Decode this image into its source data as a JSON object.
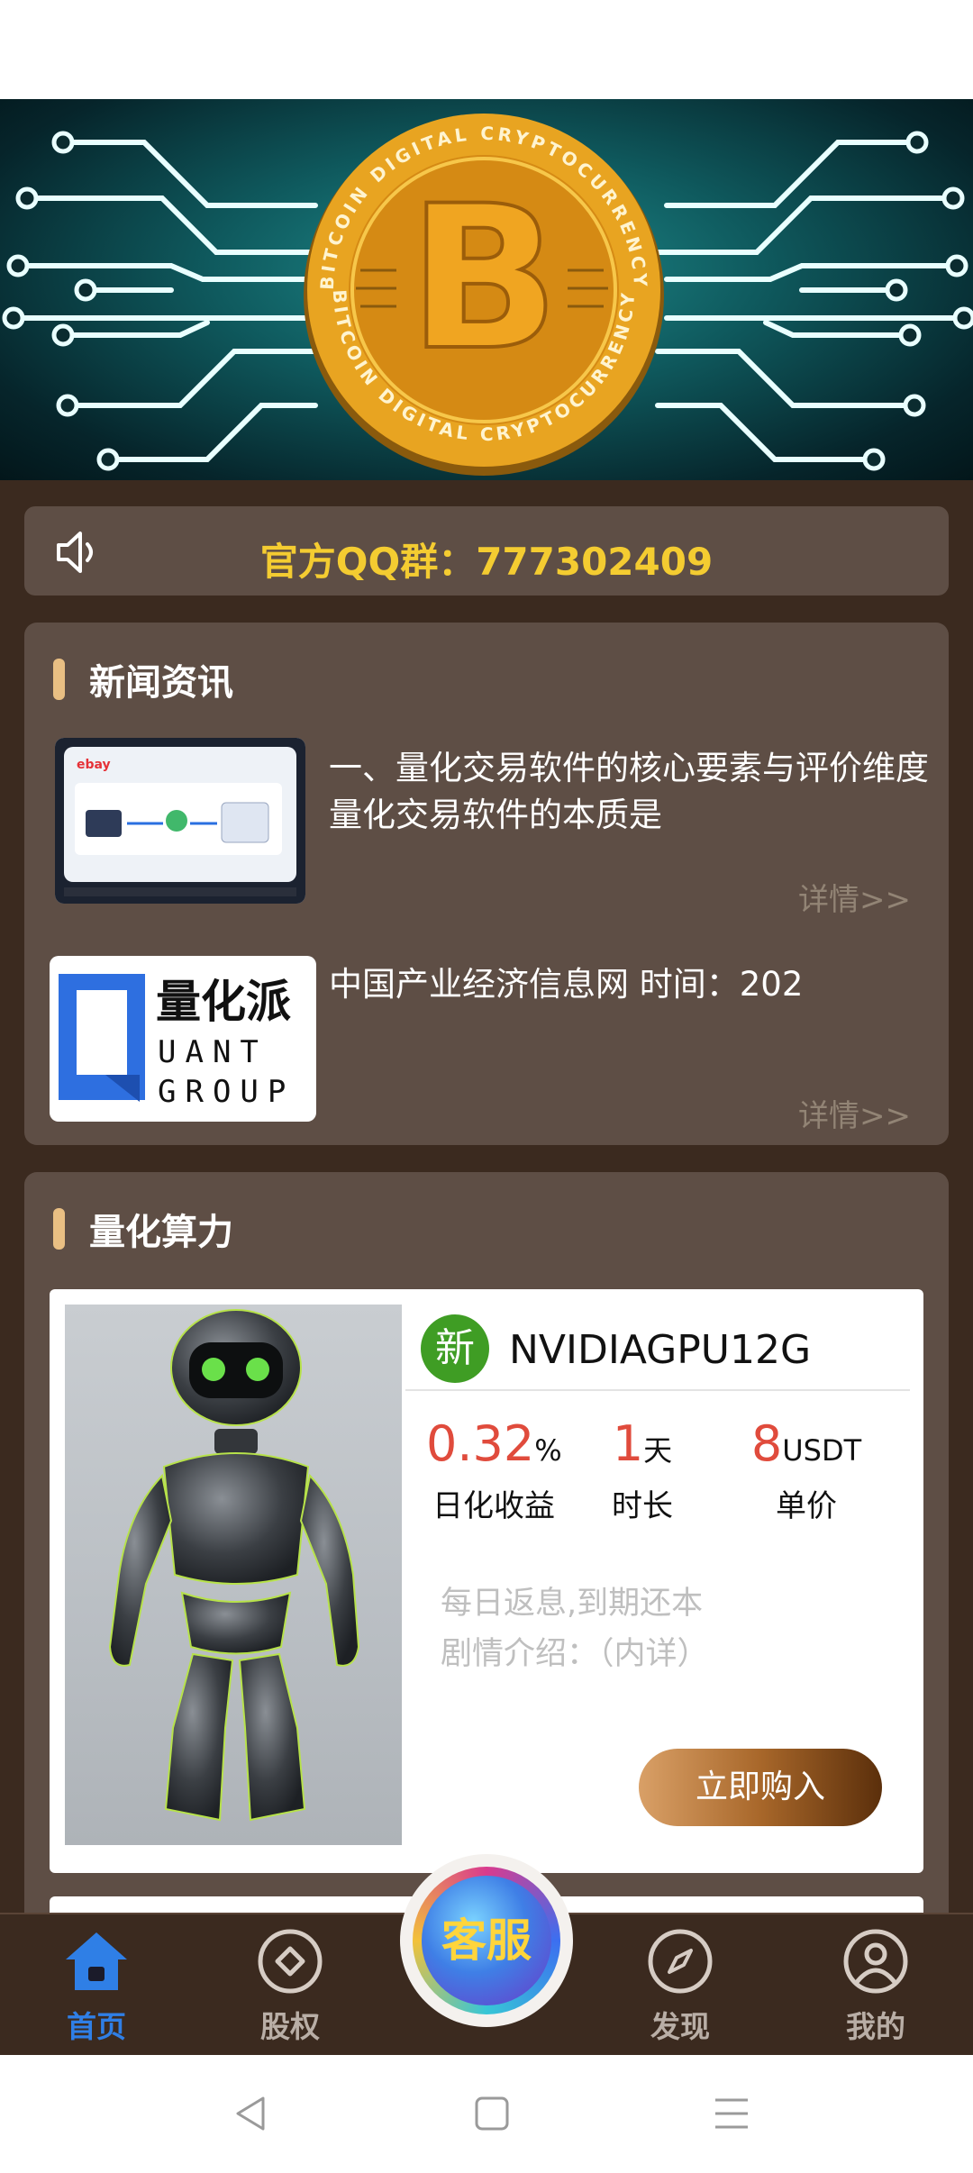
{
  "banner": {
    "coin_text_top": "BITCOIN DIGITAL CRYPTOCURRENCY",
    "coin_text_bottom": "BITCOIN DIGITAL CRYPTOCURRENCY",
    "slide_count": 4,
    "active_slide": 2
  },
  "notice": {
    "text": "官方QQ群：777302409",
    "icon": "speaker-icon"
  },
  "news": {
    "title": "新闻资讯",
    "items": [
      {
        "text": "一、量化交易软件的核心要素与评价维度量化交易软件的本质是",
        "more": "详情>>",
        "image": "rpa-tablet-thumbnail",
        "image_caption": "ebay"
      },
      {
        "text": "中国产业经济信息网   时间：202",
        "more": "详情>>",
        "image": "quant-group-logo",
        "logo_cn": "量化派",
        "logo_en1": "UANT",
        "logo_en2": "GROUP"
      }
    ]
  },
  "quant": {
    "title": "量化算力",
    "product": {
      "badge": "新",
      "name": "NVIDIAGPU12G",
      "yield_value": "0.32",
      "yield_unit": "%",
      "yield_label": "日化收益",
      "duration_value": "1",
      "duration_unit": "天",
      "duration_label": "时长",
      "price_value": "8",
      "price_unit": "USDT",
      "price_label": "单价",
      "desc1": "每日返息,到期还本",
      "desc2": "剧情介绍：（内详）",
      "buy_label": "立即购入",
      "image": "robot-image"
    }
  },
  "tabbar": {
    "items": [
      {
        "label": "首页",
        "icon": "home-icon",
        "active": true
      },
      {
        "label": "股权",
        "icon": "diamond-circle-icon",
        "active": false
      },
      {
        "label": "客服",
        "icon": "customer-service-icon",
        "active": false
      },
      {
        "label": "发现",
        "icon": "compass-icon",
        "active": false
      },
      {
        "label": "我的",
        "icon": "user-icon",
        "active": false
      }
    ]
  },
  "colors": {
    "background": "#3b2a1f",
    "card": "#5e4e45",
    "accent_yellow": "#f4cc31",
    "accent_blue": "#2f7fe6",
    "value_red": "#e04b3c",
    "badge_green": "#3f9d24"
  }
}
